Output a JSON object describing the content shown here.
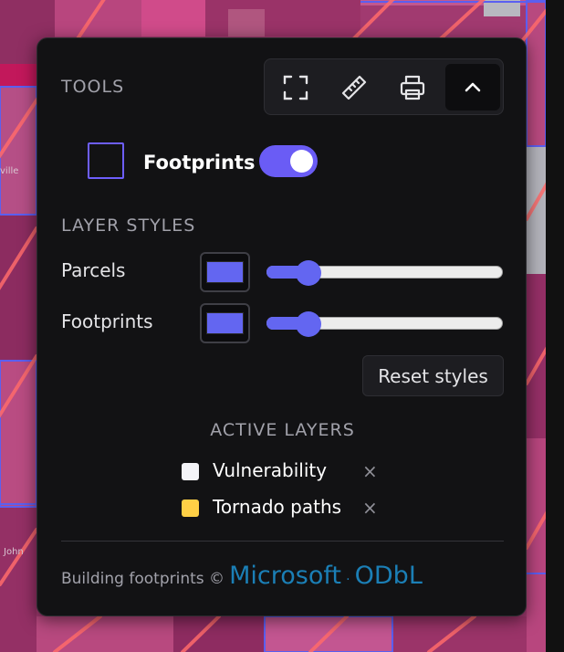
{
  "colors": {
    "accent": "#6366f1",
    "toggle": "#6a5cf5",
    "panel_bg": "#121214",
    "link": "#1b7fb6",
    "vulnerability_swatch": "#f4f4f8",
    "tornado_swatch": "#ffd046"
  },
  "tools": {
    "title": "TOOLS",
    "buttons": [
      {
        "icon": "fullscreen-icon"
      },
      {
        "icon": "ruler-icon"
      },
      {
        "icon": "printer-icon"
      },
      {
        "icon": "chevron-up-icon",
        "active": true
      }
    ]
  },
  "footprints_toggle": {
    "label": "Footprints",
    "enabled": true
  },
  "layer_styles": {
    "title": "LAYER STYLES",
    "rows": [
      {
        "label": "Parcels",
        "color": "#6366f1",
        "opacity": 0.14
      },
      {
        "label": "Footprints",
        "color": "#6366f1",
        "opacity": 0.14
      }
    ],
    "reset_label": "Reset styles"
  },
  "active_layers": {
    "title": "ACTIVE LAYERS",
    "items": [
      {
        "name": "Vulnerability",
        "color": "#f4f4f8",
        "remove_glyph": "×"
      },
      {
        "name": "Tornado paths",
        "color": "#ffd046",
        "remove_glyph": "×"
      }
    ]
  },
  "footer": {
    "prefix": "Building footprints ©",
    "link1": "Microsoft",
    "separator": "·",
    "link2": "ODbL"
  },
  "map": {
    "labels": [
      "ville",
      "John"
    ]
  }
}
